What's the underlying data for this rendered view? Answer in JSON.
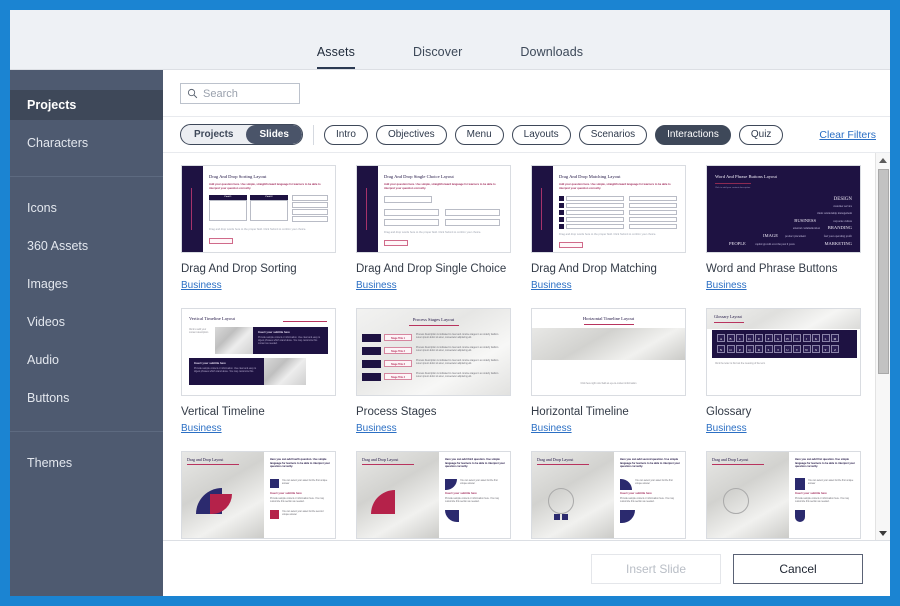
{
  "window": {
    "accent_color": "#1b84d2"
  },
  "top_tabs": [
    {
      "label": "Assets",
      "active": true
    },
    {
      "label": "Discover",
      "active": false
    },
    {
      "label": "Downloads",
      "active": false
    }
  ],
  "sidebar": {
    "groups": [
      {
        "items": [
          {
            "label": "Projects",
            "active": true
          },
          {
            "label": "Characters",
            "active": false
          }
        ]
      },
      {
        "items": [
          {
            "label": "Icons",
            "active": false
          },
          {
            "label": "360 Assets",
            "active": false
          },
          {
            "label": "Images",
            "active": false
          },
          {
            "label": "Videos",
            "active": false
          },
          {
            "label": "Audio",
            "active": false
          },
          {
            "label": "Buttons",
            "active": false
          }
        ]
      },
      {
        "items": [
          {
            "label": "Themes",
            "active": false
          }
        ]
      }
    ]
  },
  "search": {
    "placeholder": "Search",
    "value": "",
    "icon": "search-icon"
  },
  "filters": {
    "segmented": [
      {
        "label": "Projects",
        "selected": false
      },
      {
        "label": "Slides",
        "selected": true
      }
    ],
    "chips": [
      {
        "label": "Intro",
        "selected": false
      },
      {
        "label": "Objectives",
        "selected": false
      },
      {
        "label": "Menu",
        "selected": false
      },
      {
        "label": "Layouts",
        "selected": false
      },
      {
        "label": "Scenarios",
        "selected": false
      },
      {
        "label": "Interactions",
        "selected": true
      },
      {
        "label": "Quiz",
        "selected": false
      }
    ],
    "clear_label": "Clear Filters"
  },
  "cards": [
    {
      "title": "Drag And Drop Sorting",
      "category": "Business",
      "art": "dd-sorting",
      "slide_title": "Drag And Drop Sorting Layout"
    },
    {
      "title": "Drag And Drop Single Choice",
      "category": "Business",
      "art": "dd-single",
      "slide_title": "Drag And Drop Single Choice Layout"
    },
    {
      "title": "Drag And Drop Matching",
      "category": "Business",
      "art": "dd-matching",
      "slide_title": "Drag And Drop Matching Layout"
    },
    {
      "title": "Word and Phrase Buttons",
      "category": "Business",
      "art": "word-phrase",
      "slide_title": "Word And Phrase Buttons Layout"
    },
    {
      "title": "Vertical Timeline",
      "category": "Business",
      "art": "v-timeline",
      "slide_title": "Vertical Timeline Layout"
    },
    {
      "title": "Process Stages",
      "category": "Business",
      "art": "process",
      "slide_title": "Process Stages Layout"
    },
    {
      "title": "Horizontal Timeline",
      "category": "Business",
      "art": "h-timeline",
      "slide_title": "Horizontal Timeline Layout"
    },
    {
      "title": "Glossary",
      "category": "Business",
      "art": "glossary",
      "slide_title": "Glossary Layout"
    },
    {
      "title": "",
      "category": "",
      "art": "dd-photo-4",
      "slide_title": "Drag and Drop Layout"
    },
    {
      "title": "",
      "category": "",
      "art": "dd-photo-3",
      "slide_title": "Drag and Drop Layout"
    },
    {
      "title": "",
      "category": "",
      "art": "dd-photo-2",
      "slide_title": "Drag and Drop Layout"
    },
    {
      "title": "",
      "category": "",
      "art": "dd-photo-1",
      "slide_title": "Drag and Drop Layout"
    }
  ],
  "slide_text": {
    "question_prompt": "Add your question here. Use simple, straightforward language for learners to be able to interpret your question correctly.",
    "drag_hint": "Drag and drop words here to the proper field. Click Submit to confirm your choice.",
    "submit": "Submit",
    "field1": "Field 1",
    "field2": "Field 2",
    "subtitle_here": "Insert your subtitle here",
    "word_cloud": [
      "DESIGN",
      "customer service",
      "client relationship management",
      "BUSINESS",
      "corporate culture",
      "external communication",
      "BRANDING",
      "IMAGE",
      "product placement",
      "feel your operating profit",
      "PEOPLE",
      "capital growth over the past 6 years",
      "MARKETING"
    ],
    "alphabet_row1": [
      "A",
      "B",
      "C",
      "D",
      "E",
      "F",
      "G",
      "H",
      "I",
      "J",
      "K",
      "L",
      "M"
    ],
    "alphabet_row2": [
      "N",
      "O",
      "P",
      "Q",
      "R",
      "S",
      "T",
      "U",
      "V",
      "W",
      "X",
      "Y",
      "Z"
    ],
    "stage_titles": [
      "Stage Title 1",
      "Stage Title 2",
      "Stage Title 3",
      "Stage Title 4"
    ],
    "photo_q4": "Here you can add fourth question. Use simple language for learners to be able to interpret your question correctly.",
    "photo_q3": "Here you can add third question. Use simple language for learners to be able to interpret your question correctly.",
    "photo_q2": "Here you can add second question. Use simple language for learners to be able to interpret your question correctly.",
    "photo_q1": "Here you can add first question. Use simple language for learners to be able to interpret your question correctly."
  },
  "scrollbar": {
    "up_icon": "triangle-up-icon",
    "down_icon": "triangle-down-icon"
  },
  "footer": {
    "insert_label": "Insert Slide",
    "insert_disabled": true,
    "cancel_label": "Cancel"
  }
}
